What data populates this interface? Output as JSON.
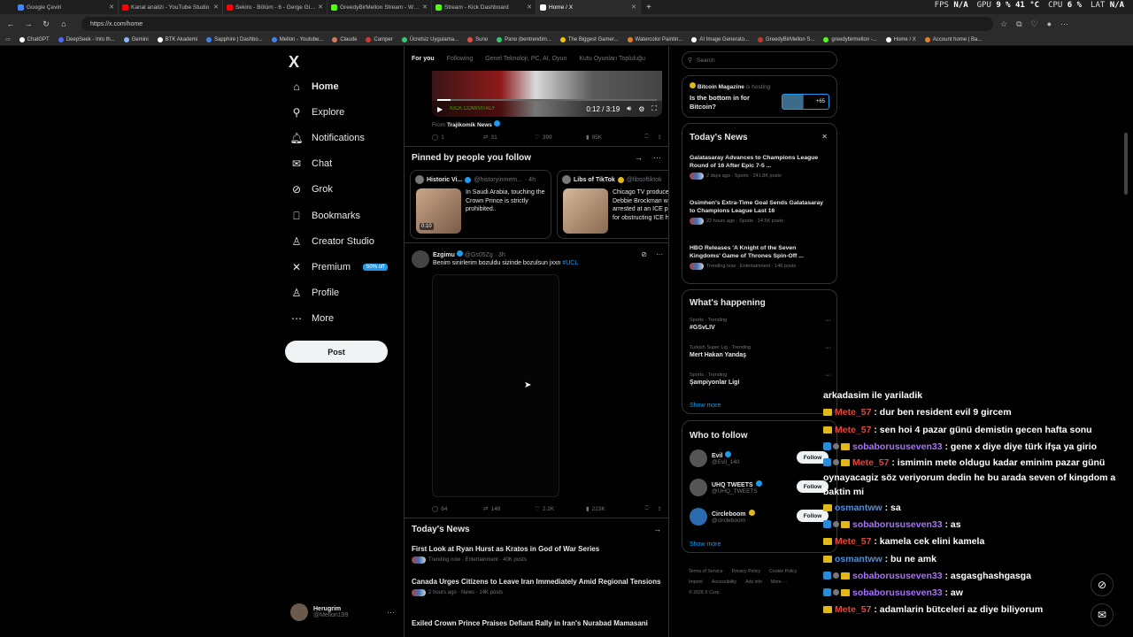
{
  "browser": {
    "tabs": [
      {
        "title": "Google Çeviri",
        "color": "#4285f4",
        "active": false
      },
      {
        "title": "Kanal analizi - YouTube Studio",
        "color": "#ff0000",
        "active": false
      },
      {
        "title": "Sekiro - Bölüm - 6 - Gerge Gigie - ...",
        "color": "#ff0000",
        "active": false
      },
      {
        "title": "GreedyBirMellon Stream - Watch ...",
        "color": "#53fc18",
        "active": false
      },
      {
        "title": "Stream - Kick Dashboard",
        "color": "#53fc18",
        "active": false
      },
      {
        "title": "Home / X",
        "color": "#ffffff",
        "active": true
      }
    ],
    "new_tab": "+",
    "url": "https://x.com/home",
    "perf": {
      "fps_label": "FPS",
      "fps_value": "N/A",
      "gpu_label": "GPU",
      "gpu_value": "9 %  41 °C",
      "cpu_label": "CPU",
      "cpu_value": "6 %",
      "lat_label": "LAT",
      "lat_value": "N/A"
    },
    "bookmarks": [
      {
        "label": "ChatGPT",
        "color": "#ffffff"
      },
      {
        "label": "DeepSeek - Into th...",
        "color": "#4d6bfe"
      },
      {
        "label": "Gemini",
        "color": "#8ab4f8"
      },
      {
        "label": "BTK Akademi",
        "color": "#ffffff"
      },
      {
        "label": "Sapphire | Dashbo...",
        "color": "#3b82f6"
      },
      {
        "label": "Mellon - Youtube...",
        "color": "#3b82f6"
      },
      {
        "label": "Claude",
        "color": "#d97757"
      },
      {
        "label": "Camper",
        "color": "#d33"
      },
      {
        "label": "Ücretsiz Uygulama...",
        "color": "#2ecc71"
      },
      {
        "label": "Suno",
        "color": "#e74c3c"
      },
      {
        "label": "Pano (bentrendim...",
        "color": "#2ecc71"
      },
      {
        "label": "The Biggest Gamer...",
        "color": "#f1c40f"
      },
      {
        "label": "Watercolor Paintin...",
        "color": "#e67e22"
      },
      {
        "label": "AI Image Generato...",
        "color": "#ffffff"
      },
      {
        "label": "GreedyBirMellon S...",
        "color": "#c0392b"
      },
      {
        "label": "greedybirmellon -...",
        "color": "#53fc18"
      },
      {
        "label": "Home / X",
        "color": "#ffffff"
      },
      {
        "label": "Account home | Ba...",
        "color": "#e67e22"
      }
    ]
  },
  "nav": {
    "logo": "X",
    "items": [
      {
        "label": "Home",
        "icon": "home-icon",
        "glyph": "⌂"
      },
      {
        "label": "Explore",
        "icon": "search-icon",
        "glyph": "⚲"
      },
      {
        "label": "Notifications",
        "icon": "bell-icon",
        "glyph": "🔔︎"
      },
      {
        "label": "Chat",
        "icon": "mail-icon",
        "glyph": "✉"
      },
      {
        "label": "Grok",
        "icon": "grok-icon",
        "glyph": "⊘"
      },
      {
        "label": "Bookmarks",
        "icon": "bookmark-icon",
        "glyph": "⎕"
      },
      {
        "label": "Creator Studio",
        "icon": "creator-icon",
        "glyph": "♙"
      },
      {
        "label": "Premium",
        "icon": "x-premium-icon",
        "glyph": "✕"
      },
      {
        "label": "Profile",
        "icon": "person-icon",
        "glyph": "♙"
      },
      {
        "label": "More",
        "icon": "more-circle-icon",
        "glyph": "⋯"
      }
    ],
    "premium_badge": "50% off",
    "post_label": "Post",
    "account": {
      "name": "Herugrim",
      "handle": "@Mellon199",
      "more": "···"
    }
  },
  "feed": {
    "tabs": [
      "For you",
      "Following",
      "Genel Teknoloji, PC, AI, Oyun",
      "Kutu Oyunları Topluluğu"
    ],
    "video": {
      "time": "0:12 / 3:19",
      "watermark": "KICK.COM/VITALY",
      "progress": 0.06
    },
    "from_label": "From",
    "from_source": "Trajikomik News",
    "post1_actions": {
      "replies": "1",
      "reposts": "31",
      "likes": "399",
      "views": "95K"
    },
    "pinned_title": "Pinned by people you follow",
    "pinned": [
      {
        "name": "Historic Vi...",
        "handle": "@historyinmem...",
        "time": "· 4h",
        "text": "In Saudi Arabia, touching the Crown Prince is strictly prohibited..",
        "duration": "0:10"
      },
      {
        "name": "Libs of TikTok",
        "handle": "@libsoftiktok",
        "time": "",
        "text": "Chicago TV producer Debbie Brockman was arrested at an ICE protest for obstructing ICE ha"
      }
    ],
    "post2": {
      "name": "Ezgimu",
      "handle": "@Gs05Zg",
      "time": "· 3h",
      "text": "Benim sinirlerim bozuldu sizinde bozulsun jxxn",
      "hashtag": "#UCL"
    },
    "post2_actions": {
      "replies": "64",
      "reposts": "148",
      "likes": "2.2K",
      "views": "223K"
    },
    "news_title": "Today's News",
    "news": [
      {
        "headline": "First Look at Ryan Hurst as Kratos in God of War Series",
        "meta": "Trending now · Entertainment · 40K posts"
      },
      {
        "headline": "Canada Urges Citizens to Leave Iran Immediately Amid Regional Tensions",
        "meta": "2 hours ago · News · 14K posts"
      },
      {
        "headline": "Exiled Crown Prince Praises Defiant Rally in Iran's Nurabad Mamasani",
        "meta": ""
      }
    ]
  },
  "sidebar": {
    "search_placeholder": "Search",
    "spaces": {
      "host": "Bitcoin Magazine",
      "hosting": "is hosting",
      "question": "Is the bottom in for Bitcoin?",
      "listeners": "+65"
    },
    "todays_news_title": "Today's News",
    "todays_news": [
      {
        "headline": "Galatasaray Advances to Champions League Round of 16 After Epic 7-5 ...",
        "meta": "2 days ago · Sports · 241.8K posts"
      },
      {
        "headline": "Osimhen's Extra-Time Goal Sends Galatasaray to Champions League Last 16",
        "meta": "22 hours ago · Sports · 14.5K posts"
      },
      {
        "headline": "HBO Releases 'A Knight of the Seven Kingdoms' Game of Thrones Spin-Off ...",
        "meta": "Trending now · Entertainment · 146 posts"
      }
    ],
    "happening_title": "What's happening",
    "happening": [
      {
        "context": "Sports · Trending",
        "topic": "#GSvLIV"
      },
      {
        "context": "Turkish Super Lig · Trending",
        "topic": "Mert Hakan Yandaş"
      },
      {
        "context": "Sports · Trending",
        "topic": "Şampiyonlar Ligi"
      }
    ],
    "show_more": "Show more",
    "wtf_title": "Who to follow",
    "wtf": [
      {
        "name": "Evil",
        "handle": "@Evil_140"
      },
      {
        "name": "UHQ TWEETS",
        "handle": "@UHQ_TWEETS"
      },
      {
        "name": "Circleboom",
        "handle": "@circleboom"
      }
    ],
    "follow_label": "Follow",
    "footer": [
      "Terms of Service",
      "Privacy Policy",
      "Cookie Policy",
      "Imprint",
      "Accessibility",
      "Ads info",
      "More ···",
      "© 2026 X Corp."
    ]
  },
  "chat": {
    "lines": [
      {
        "user": "",
        "text": "arkadasim ile yariladik",
        "badges": "none",
        "color": ""
      },
      {
        "user": "Mete_57",
        "text": " : dur ben resident evil 9 gircem",
        "badges": "crown",
        "color": "red"
      },
      {
        "user": "Mete_57",
        "text": " : sen hoi 4 pazar günü demistin gecen hafta sonu",
        "badges": "crown",
        "color": "red"
      },
      {
        "user": "sobaborususeven33",
        "text": " : gene x diye diye türk ifşa ya girio",
        "badges": "full",
        "color": "purple"
      },
      {
        "user": "Mete_57",
        "text": " : ismimin mete oldugu kadar eminim pazar günü oynayacagiz söz veriyorum dedin he bu arada seven of kingdom a baktin mi",
        "badges": "full",
        "color": "red"
      },
      {
        "user": "osmantww",
        "text": " : sa",
        "badges": "crown",
        "color": "blue"
      },
      {
        "user": "sobaborususeven33",
        "text": " : as",
        "badges": "full",
        "color": "purple"
      },
      {
        "user": "Mete_57",
        "text": " : kamela cek elini kamela",
        "badges": "crown",
        "color": "red"
      },
      {
        "user": "osmantww",
        "text": " : bu ne amk",
        "badges": "crown",
        "color": "blue"
      },
      {
        "user": "sobaborususeven33",
        "text": " : asgasghashgasga",
        "badges": "full",
        "color": "purple"
      },
      {
        "user": "sobaborususeven33",
        "text": " : aw",
        "badges": "full",
        "color": "purple"
      },
      {
        "user": "Mete_57",
        "text": " : adamlarin bütceleri az diye biliyorum",
        "badges": "crown",
        "color": "red"
      }
    ]
  }
}
